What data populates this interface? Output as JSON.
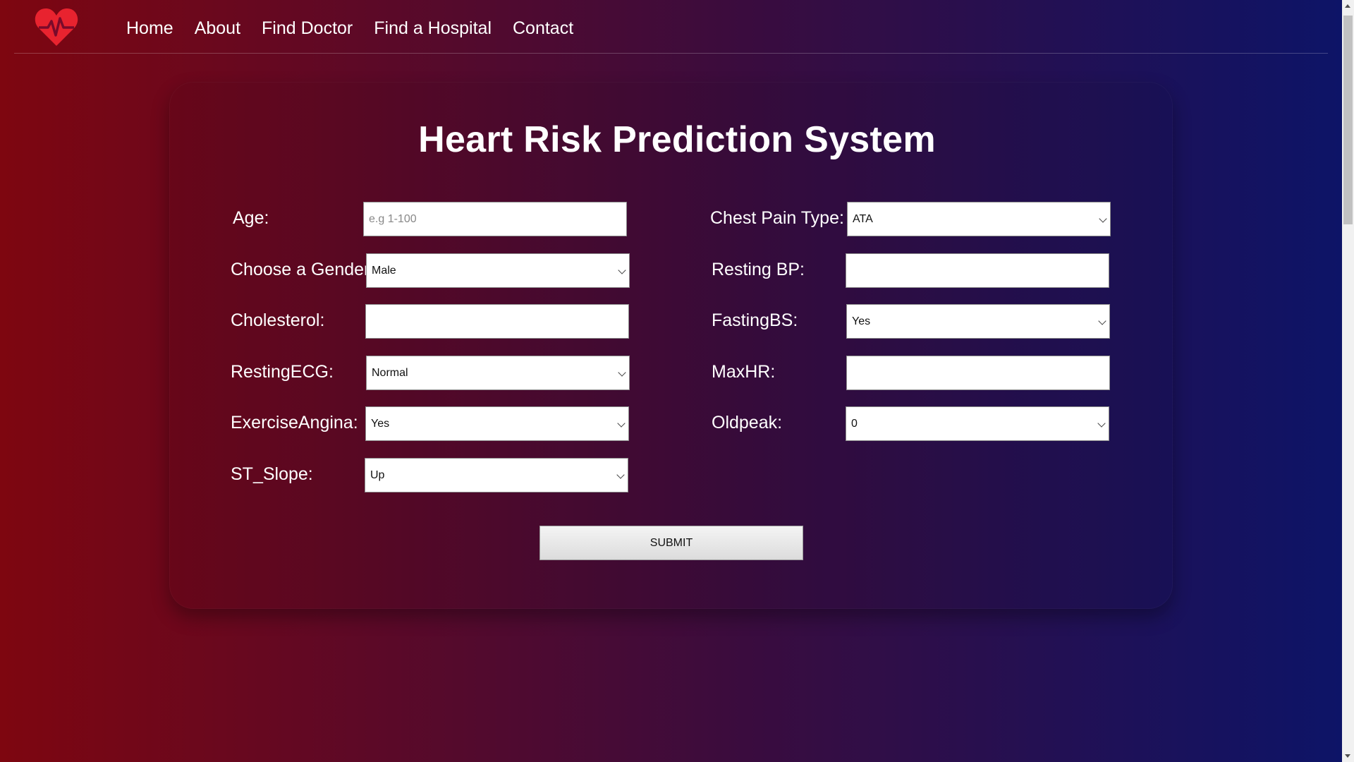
{
  "nav": {
    "logo_icon": "heart-pulse-icon",
    "links": [
      "Home",
      "About",
      "Find Doctor",
      "Find a Hospital",
      "Contact"
    ]
  },
  "form": {
    "title": "Heart Risk Prediction System",
    "age": {
      "label": "Age:",
      "placeholder": "e.g 1-100",
      "value": ""
    },
    "gender": {
      "label": "Choose a Gender:",
      "value": "Male"
    },
    "cholesterol": {
      "label": "Cholesterol:",
      "value": ""
    },
    "resting_ecg": {
      "label": "RestingECG:",
      "value": "Normal"
    },
    "exercise_angina": {
      "label": "ExerciseAngina:",
      "value": "Yes"
    },
    "st_slope": {
      "label": "ST_Slope:",
      "value": "Up"
    },
    "chest_pain": {
      "label": "Chest Pain Type:",
      "value": "ATA"
    },
    "resting_bp": {
      "label": "Resting BP:",
      "value": ""
    },
    "fasting_bs": {
      "label": "FastingBS:",
      "value": "Yes"
    },
    "max_hr": {
      "label": "MaxHR:",
      "value": ""
    },
    "oldpeak": {
      "label": "Oldpeak:",
      "value": "0"
    },
    "submit_label": "SUBMIT"
  },
  "colors": {
    "gradient_left": "#7e0610",
    "gradient_right": "#0c1468",
    "logo_red": "#e8232f"
  }
}
